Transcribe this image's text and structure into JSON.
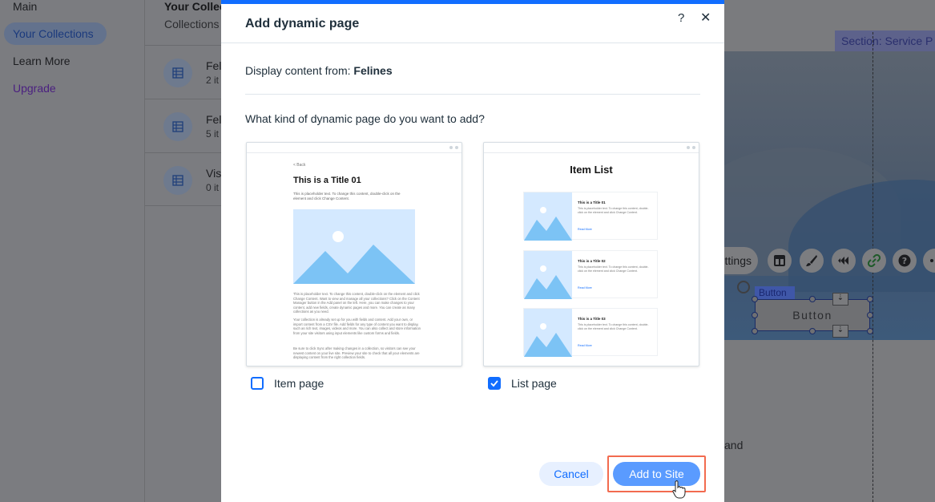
{
  "background": {
    "sidebar": {
      "items": [
        "Main",
        "Your Collections",
        "Learn More",
        "Upgrade"
      ]
    },
    "collections_panel": {
      "title": "Your Collec",
      "subtitle": "Collections",
      "rows": [
        {
          "name": "Fel",
          "count": "2 it"
        },
        {
          "name": "Fel",
          "count": "5 it"
        },
        {
          "name": "Vis",
          "count": "0 it"
        }
      ]
    },
    "editor": {
      "section_label": "Section: Service P",
      "settings_label": "ttings",
      "button_tag": "Button",
      "button_text": "Button",
      "partial_text": "and"
    }
  },
  "modal": {
    "title": "Add dynamic page",
    "help_label": "?",
    "close_label": "✕",
    "source_prefix": "Display content from: ",
    "source_name": "Felines",
    "question": "What kind of dynamic page do you want to add?",
    "item_preview": {
      "back": "< Back",
      "title": "This is a Title 01",
      "intro": "This is placeholder text. To change this content, double-click on the element and click Change Content.",
      "body1": "This is placeholder text. To change this content, double-click on the element and click Change Content. Want to view and manage all your collections? Click on the Content Manager button in the Add panel on the left. Here, you can make changes to your content, add new fields, create dynamic pages and more. You can create as many collections as you need.",
      "body2": "Your collection is already set up for you with fields and content. Add your own, or import content from a CSV file. Add fields for any type of content you want to display, such as rich text, images, videos and more. You can also collect and store information from your site visitors using input elements like custom forms and fields.",
      "body3": "Be sure to click Sync after making changes in a collection, so visitors can see your newest content on your live site. Preview your site to check that all your elements are displaying content from the right collection fields."
    },
    "list_preview": {
      "title": "Item List",
      "items": [
        {
          "title": "This is a Title 01",
          "desc": "This is placeholder text. To change this content, double-click on the element and click Change Content.",
          "read": "Read More"
        },
        {
          "title": "This is a Title 02",
          "desc": "This is placeholder text. To change this content, double-click on the element and click Change Content.",
          "read": "Read More"
        },
        {
          "title": "This is a Title 03",
          "desc": "This is placeholder text. To change this content, double-click on the element and click Change Content.",
          "read": "Read More"
        }
      ]
    },
    "options": [
      {
        "label": "Item page",
        "checked": false
      },
      {
        "label": "List page",
        "checked": true
      }
    ],
    "cancel_label": "Cancel",
    "add_label": "Add to Site"
  },
  "colors": {
    "accent": "#116dff",
    "primary_button": "#5a9bff",
    "highlight_frame": "#f26b4f",
    "placeholder_image": "#d4e9ff",
    "placeholder_mountain": "#7cc3f5"
  }
}
